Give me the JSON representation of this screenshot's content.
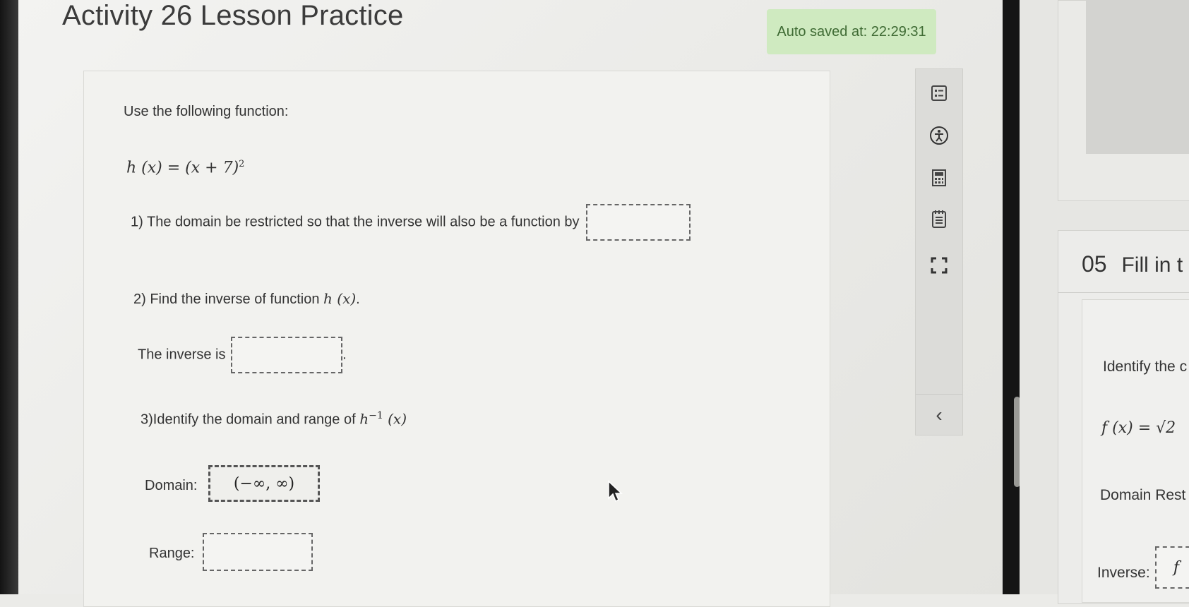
{
  "header": {
    "title": "Activity 26 Lesson Practice",
    "autosave": "Auto saved at: 22:29:31"
  },
  "question": {
    "intro": "Use the following function:",
    "function_lhs": "h (x) = (x + 7)",
    "function_exp": "2",
    "q1": "1) The domain be restricted so that the inverse will also be a function by",
    "q2_prefix": "2) Find the inverse of function ",
    "q2_math": "h (x)",
    "q2_suffix": ".",
    "inverse_label": "The inverse is",
    "inverse_suffix": ".",
    "q3_prefix": "3)Identify the domain and range of ",
    "q3_math_h": "h",
    "q3_math_sup": "−1",
    "q3_math_arg": " (x)",
    "domain_label": "Domain:",
    "domain_value": "(−∞, ∞)",
    "range_label": "Range:"
  },
  "toolbar": {
    "icons": [
      "list-icon",
      "accessibility-icon",
      "calculator-icon",
      "notepad-icon",
      "fullscreen-icon"
    ],
    "collapse": "‹"
  },
  "right_pane": {
    "question_number": "05",
    "question_title": "Fill in t",
    "identify": "Identify the c",
    "function": "f (x) = √2",
    "domain_rest": "Domain Rest",
    "inverse": "Inverse:",
    "inverse_box": "f"
  }
}
